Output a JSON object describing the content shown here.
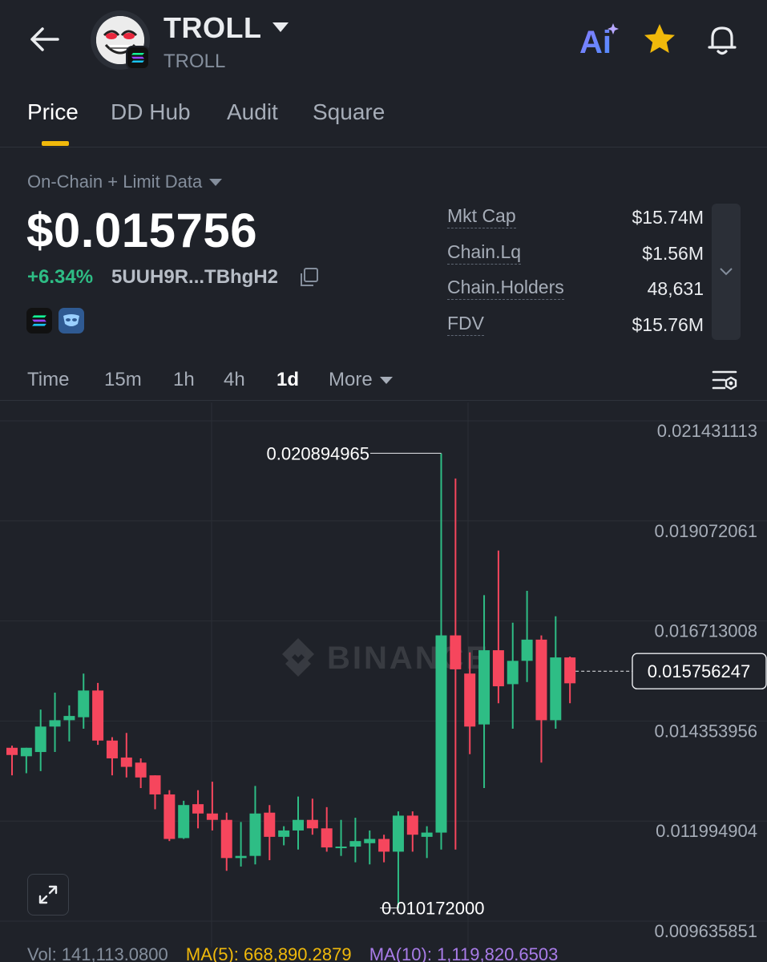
{
  "header": {
    "token_name": "TROLL",
    "token_sub": "TROLL",
    "ai_label": "Ai"
  },
  "tabs": [
    {
      "label": "Price",
      "active": true
    },
    {
      "label": "DD Hub",
      "active": false
    },
    {
      "label": "Audit",
      "active": false
    },
    {
      "label": "Square",
      "active": false
    }
  ],
  "summary": {
    "datasource": "On-Chain + Limit Data",
    "price": "$0.015756",
    "change": "+6.34%",
    "address": "5UUH9R...TBhgH2"
  },
  "stats": [
    {
      "label": "Mkt Cap",
      "value": "$15.74M"
    },
    {
      "label": "Chain.Lq",
      "value": "$1.56M"
    },
    {
      "label": "Chain.Holders",
      "value": "48,631"
    },
    {
      "label": "FDV",
      "value": "$15.76M"
    }
  ],
  "intervals": [
    "Time",
    "15m",
    "1h",
    "4h",
    "1d",
    "More"
  ],
  "active_interval": "1d",
  "colors": {
    "up": "#2ebd85",
    "down": "#f6465d",
    "accent": "#f0b90b",
    "ma5": "#f0b90b",
    "ma10": "#a97ce8"
  },
  "chart_data": {
    "type": "candlestick",
    "watermark": "BINANCE",
    "y_axis_labels": [
      "0.021431113",
      "0.019072061",
      "0.016713008",
      "0.014353956",
      "0.011994904",
      "0.009635851"
    ],
    "ylim": [
      0.009635851,
      0.021431113
    ],
    "current_price_label": "0.015756247",
    "current_price": 0.015756247,
    "high_label": "0.020894965",
    "high": 0.020894965,
    "low_label": "0.010172000",
    "low": 0.010172,
    "candles": [
      {
        "o": 0.01395,
        "h": 0.014,
        "l": 0.0133,
        "c": 0.01378
      },
      {
        "o": 0.01375,
        "h": 0.01395,
        "l": 0.01335,
        "c": 0.01395
      },
      {
        "o": 0.01385,
        "h": 0.01485,
        "l": 0.0134,
        "c": 0.01445
      },
      {
        "o": 0.01445,
        "h": 0.01525,
        "l": 0.01385,
        "c": 0.0146
      },
      {
        "o": 0.0146,
        "h": 0.01495,
        "l": 0.0141,
        "c": 0.0147
      },
      {
        "o": 0.01467,
        "h": 0.0157,
        "l": 0.0144,
        "c": 0.0153
      },
      {
        "o": 0.0153,
        "h": 0.01548,
        "l": 0.01402,
        "c": 0.01412
      },
      {
        "o": 0.01412,
        "h": 0.0142,
        "l": 0.0133,
        "c": 0.0137
      },
      {
        "o": 0.01372,
        "h": 0.0143,
        "l": 0.01325,
        "c": 0.0135
      },
      {
        "o": 0.0136,
        "h": 0.0137,
        "l": 0.013,
        "c": 0.01325
      },
      {
        "o": 0.0133,
        "h": 0.0133,
        "l": 0.0125,
        "c": 0.01285
      },
      {
        "o": 0.01285,
        "h": 0.01295,
        "l": 0.01175,
        "c": 0.0118
      },
      {
        "o": 0.01182,
        "h": 0.0127,
        "l": 0.0118,
        "c": 0.0126
      },
      {
        "o": 0.01262,
        "h": 0.01295,
        "l": 0.01205,
        "c": 0.0124
      },
      {
        "o": 0.0124,
        "h": 0.01315,
        "l": 0.012,
        "c": 0.01225
      },
      {
        "o": 0.01225,
        "h": 0.01242,
        "l": 0.01105,
        "c": 0.01135
      },
      {
        "o": 0.01135,
        "h": 0.0122,
        "l": 0.01115,
        "c": 0.0114
      },
      {
        "o": 0.0114,
        "h": 0.01305,
        "l": 0.0112,
        "c": 0.0124
      },
      {
        "o": 0.01242,
        "h": 0.0126,
        "l": 0.0113,
        "c": 0.01185
      },
      {
        "o": 0.01185,
        "h": 0.0121,
        "l": 0.01165,
        "c": 0.012
      },
      {
        "o": 0.012,
        "h": 0.0128,
        "l": 0.01155,
        "c": 0.01225
      },
      {
        "o": 0.01225,
        "h": 0.01275,
        "l": 0.0119,
        "c": 0.01205
      },
      {
        "o": 0.01205,
        "h": 0.01255,
        "l": 0.0115,
        "c": 0.0116
      },
      {
        "o": 0.0116,
        "h": 0.01225,
        "l": 0.0114,
        "c": 0.01162
      },
      {
        "o": 0.01162,
        "h": 0.0123,
        "l": 0.01125,
        "c": 0.01175
      },
      {
        "o": 0.0117,
        "h": 0.012,
        "l": 0.0112,
        "c": 0.0118
      },
      {
        "o": 0.0118,
        "h": 0.0119,
        "l": 0.01125,
        "c": 0.0115
      },
      {
        "o": 0.0115,
        "h": 0.01245,
        "l": 0.01017,
        "c": 0.01235
      },
      {
        "o": 0.01235,
        "h": 0.01245,
        "l": 0.0115,
        "c": 0.0119
      },
      {
        "o": 0.01185,
        "h": 0.0121,
        "l": 0.01135,
        "c": 0.01195
      },
      {
        "o": 0.01195,
        "h": 0.02089,
        "l": 0.01155,
        "c": 0.0166
      },
      {
        "o": 0.0166,
        "h": 0.0203,
        "l": 0.01155,
        "c": 0.0158
      },
      {
        "o": 0.0157,
        "h": 0.0162,
        "l": 0.0138,
        "c": 0.01445
      },
      {
        "o": 0.0145,
        "h": 0.01755,
        "l": 0.013,
        "c": 0.01625
      },
      {
        "o": 0.01625,
        "h": 0.0186,
        "l": 0.015,
        "c": 0.0154
      },
      {
        "o": 0.01545,
        "h": 0.0169,
        "l": 0.0144,
        "c": 0.016
      },
      {
        "o": 0.016,
        "h": 0.01765,
        "l": 0.0155,
        "c": 0.0165
      },
      {
        "o": 0.0165,
        "h": 0.0166,
        "l": 0.0136,
        "c": 0.0146
      },
      {
        "o": 0.0146,
        "h": 0.01705,
        "l": 0.0144,
        "c": 0.01608
      },
      {
        "o": 0.01608,
        "h": 0.0161,
        "l": 0.015,
        "c": 0.01547
      }
    ]
  },
  "volume_bar": {
    "vol": "Vol: 141,113.0800",
    "ma5": "MA(5): 668,890.2879",
    "ma10": "MA(10): 1,119,820.6503"
  }
}
